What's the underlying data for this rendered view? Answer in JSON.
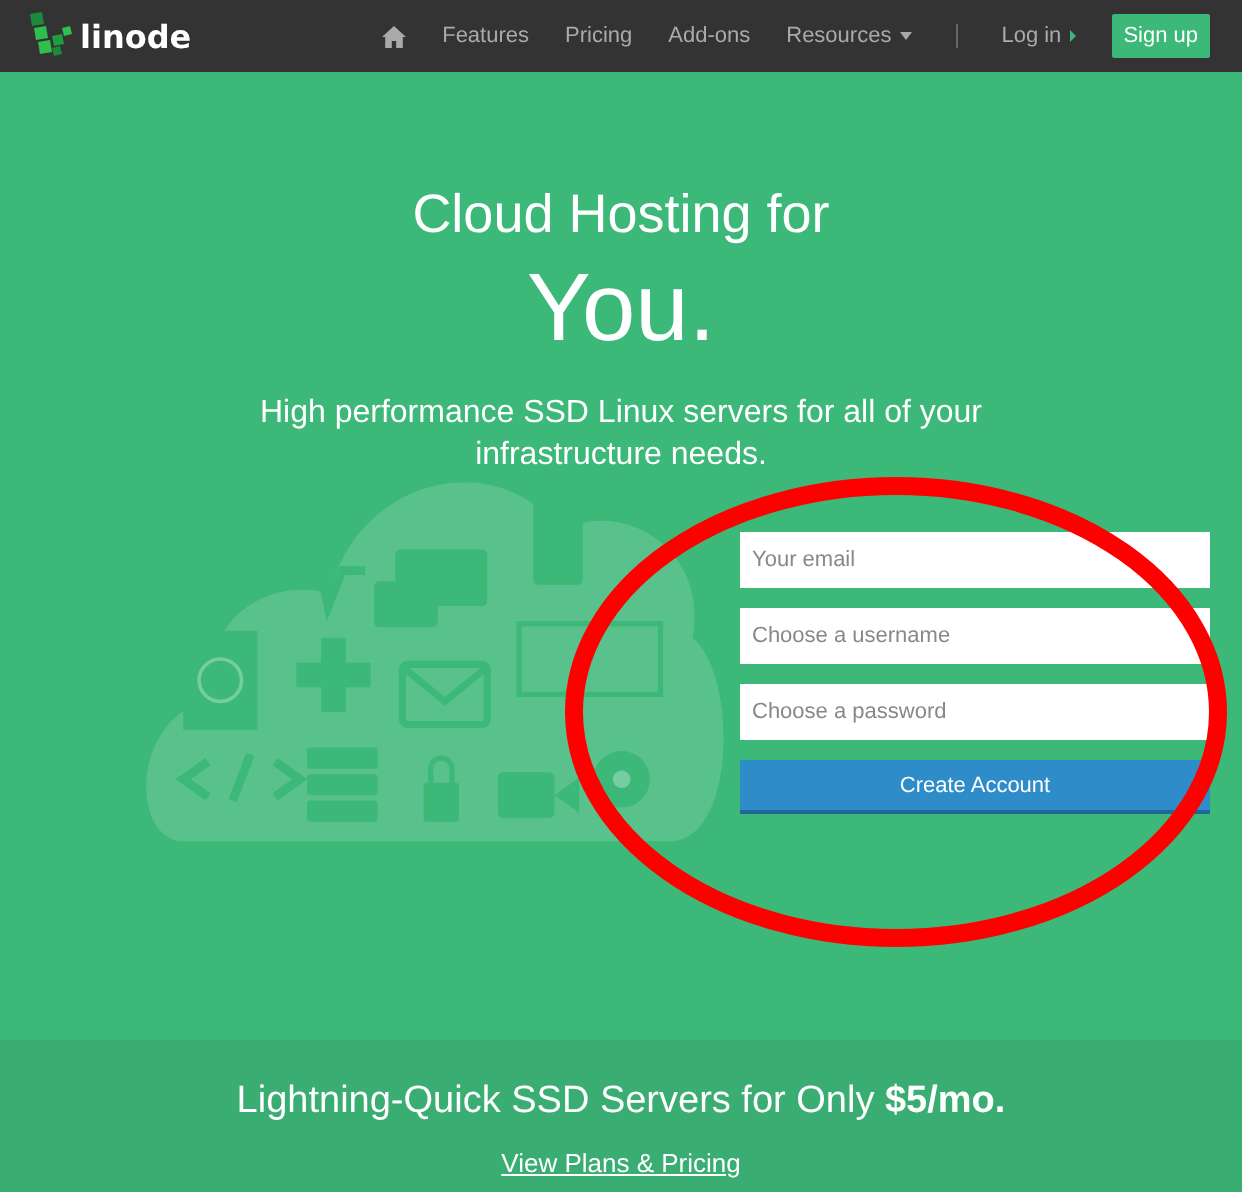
{
  "nav": {
    "logo": "linode",
    "items": [
      {
        "kind": "home"
      },
      {
        "kind": "link",
        "label": "Features"
      },
      {
        "kind": "link",
        "label": "Pricing"
      },
      {
        "kind": "link",
        "label": "Add-ons"
      },
      {
        "kind": "dropdown",
        "label": "Resources"
      },
      {
        "kind": "divider"
      },
      {
        "kind": "arrow",
        "label": "Log in"
      },
      {
        "kind": "button",
        "label": "Sign up"
      }
    ]
  },
  "hero": {
    "title": "Cloud Hosting for",
    "title_big": "You.",
    "subtitle": "High performance SSD Linux servers for all of your infrastructure needs.",
    "form": {
      "fields": [
        {
          "placeholder": "Your email"
        },
        {
          "placeholder": "Choose a username"
        },
        {
          "placeholder": "Choose a password"
        }
      ],
      "submit": "Create Account"
    }
  },
  "promo": {
    "text": "Lightning-Quick SSD Servers for Only **$5/mo.**",
    "link": "View Plans & Pricing"
  },
  "annotations": [
    {
      "kind": "ellipse"
    }
  ]
}
